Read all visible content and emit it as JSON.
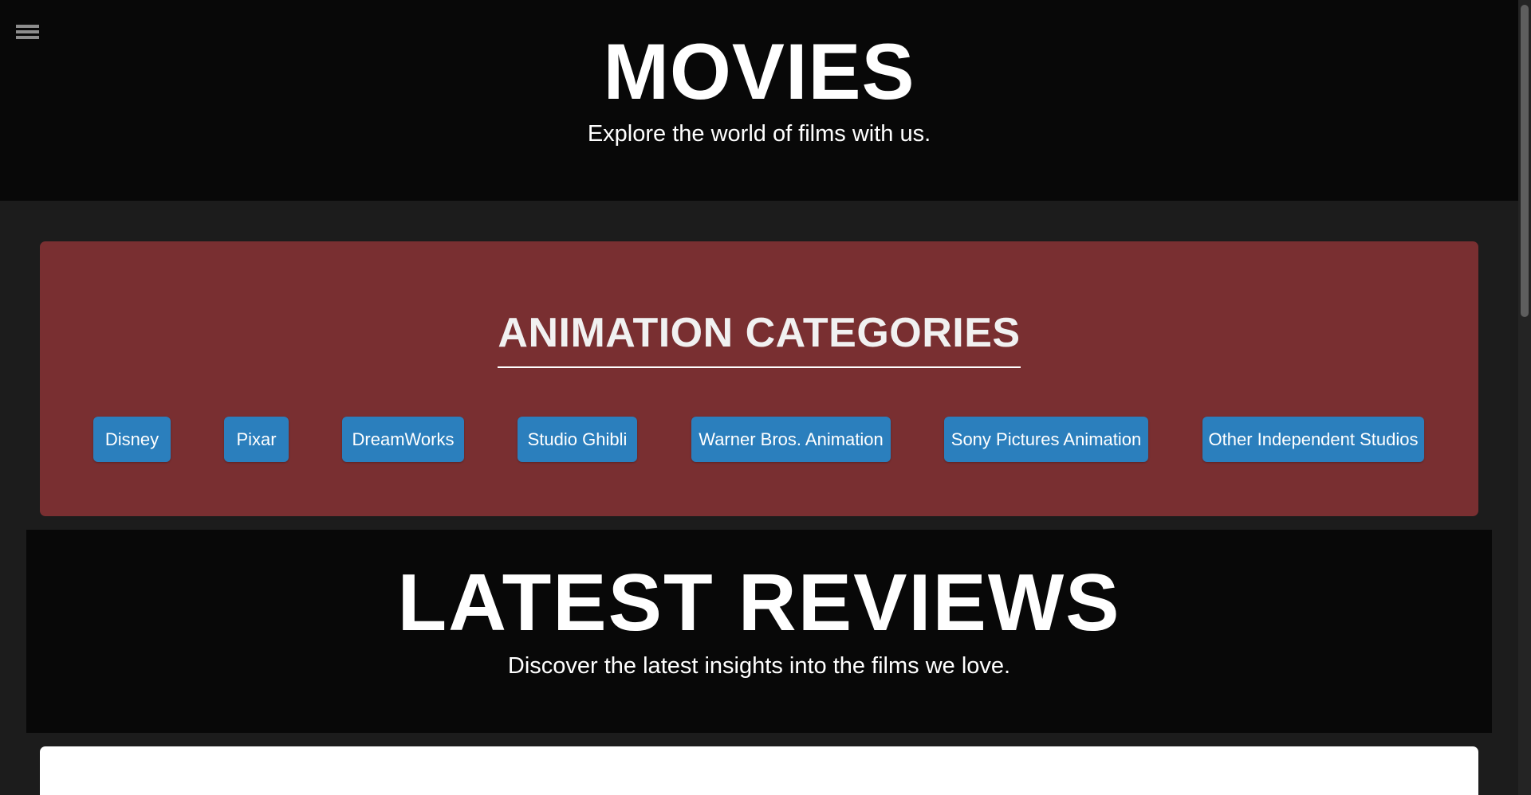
{
  "header": {
    "title": "MOVIES",
    "tagline": "Explore the world of films with us."
  },
  "categories": {
    "heading": "ANIMATION CATEGORIES",
    "items": [
      {
        "label": "Disney"
      },
      {
        "label": "Pixar"
      },
      {
        "label": "DreamWorks"
      },
      {
        "label": "Studio Ghibli"
      },
      {
        "label": "Warner Bros. Animation"
      },
      {
        "label": "Sony Pictures Animation"
      },
      {
        "label": "Other Independent Studios"
      }
    ]
  },
  "reviews": {
    "title": "LATEST REVIEWS",
    "subtitle": "Discover the latest insights into the films we love."
  },
  "icons": {
    "menu": "hamburger-menu-icon"
  },
  "colors": {
    "header_bg": "#080808",
    "page_bg": "#1c1c1c",
    "categories_bg": "#792f31",
    "button_bg": "#2b7fbd",
    "text": "#ffffff"
  }
}
